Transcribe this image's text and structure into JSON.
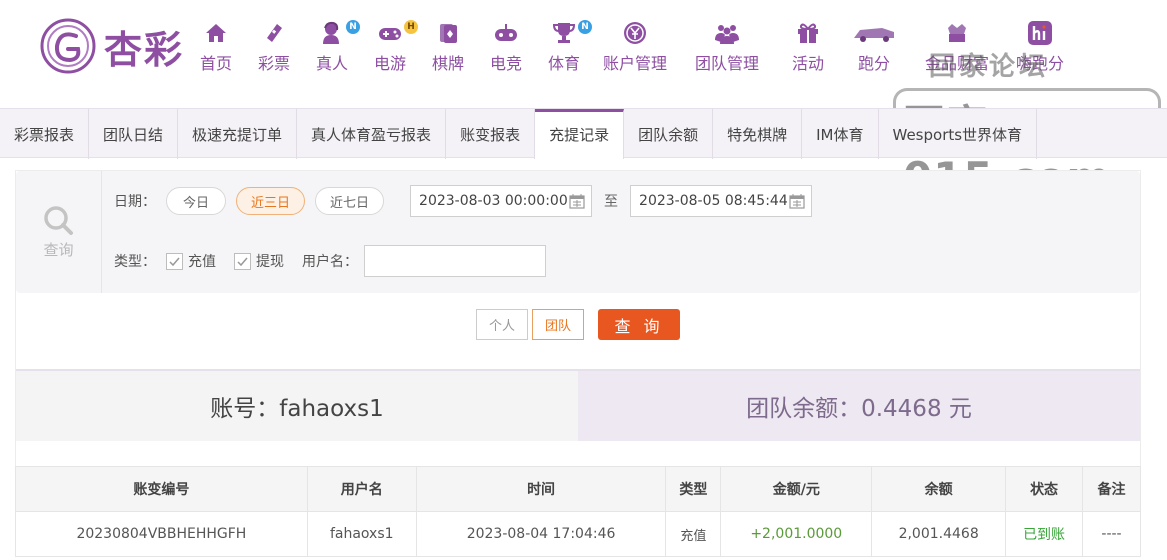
{
  "app": {
    "brand": "杏彩"
  },
  "nav": [
    {
      "label": "首页",
      "icon": "home-icon"
    },
    {
      "label": "彩票",
      "icon": "ticket-icon"
    },
    {
      "label": "真人",
      "icon": "live-dealer-icon",
      "badge": "N"
    },
    {
      "label": "电游",
      "icon": "gamepad-icon",
      "badge": "H"
    },
    {
      "label": "棋牌",
      "icon": "cards-icon"
    },
    {
      "label": "电竞",
      "icon": "esports-icon"
    },
    {
      "label": "体育",
      "icon": "trophy-icon",
      "badge": "N"
    },
    {
      "label": "账户管理",
      "icon": "yen-coin-icon"
    },
    {
      "label": "团队管理",
      "icon": "team-icon"
    },
    {
      "label": "活动",
      "icon": "gift-icon"
    },
    {
      "label": "跑分",
      "icon": "car-icon"
    },
    {
      "label": "金品财富",
      "icon": "treasure-icon"
    },
    {
      "label": "嗨跑分",
      "icon": "hi-app-icon"
    }
  ],
  "watermark": {
    "top": "回家论坛",
    "main": "回家015.com"
  },
  "tabs": [
    "彩票报表",
    "团队日结",
    "极速充提订单",
    "真人体育盈亏报表",
    "账变报表",
    "充提记录",
    "团队余额",
    "特免棋牌",
    "IM体育",
    "Wesports世界体育"
  ],
  "active_tab": "充提记录",
  "filter": {
    "search_label": "查询",
    "date_label": "日期：",
    "quick_ranges": [
      "今日",
      "近三日",
      "近七日"
    ],
    "active_range": "近三日",
    "start_date": "2023-08-03 00:00:00",
    "to_label": "至",
    "end_date": "2023-08-05 08:45:44",
    "type_label": "类型：",
    "types": [
      {
        "label": "充值",
        "checked": true
      },
      {
        "label": "提现",
        "checked": true
      }
    ],
    "username_label": "用户名：",
    "username_value": ""
  },
  "scope": {
    "personal": "个人",
    "team": "团队",
    "query": "查 询"
  },
  "summary": {
    "account": "账号：fahaoxs1",
    "team_balance": "团队余额：0.4468 元"
  },
  "table": {
    "columns": [
      "账变编号",
      "用户名",
      "时间",
      "类型",
      "金额/元",
      "余额",
      "状态",
      "备注"
    ],
    "rows": [
      [
        "20230804VBBHEHHGFH",
        "fahaoxs1",
        "2023-08-04 17:04:46",
        "充值",
        "+2,001.0000",
        "2,001.4468",
        "已到账",
        "----"
      ]
    ]
  },
  "colors": {
    "brand": "#8e4fa3",
    "accent": "#e8571f",
    "success": "#3aa63a"
  }
}
